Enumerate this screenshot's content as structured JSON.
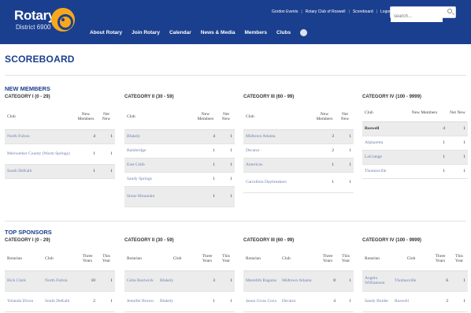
{
  "header": {
    "logo": {
      "name": "Rotary",
      "district": "District 6900"
    },
    "utility_links": [
      "Gordon Events",
      "Rotary Club of Roswell",
      "Scoreboard",
      "Logout"
    ],
    "search": {
      "placeholder": "search..."
    },
    "nav": [
      "About Rotary",
      "Join Rotary",
      "Calendar",
      "News & Media",
      "Members",
      "Clubs"
    ]
  },
  "page": {
    "title": "SCOREBOARD"
  },
  "new_members": {
    "title": "NEW MEMBERS",
    "categories": [
      {
        "title": "CATEGORY I (0 - 29)",
        "headers": [
          "Club",
          "New Members",
          "Net New"
        ],
        "rows": [
          [
            "North Fulton",
            "4",
            "1"
          ],
          [
            "Meriwether County (Warm Springs)",
            "1",
            "1"
          ],
          [
            "South DeKalb",
            "1",
            "1"
          ]
        ]
      },
      {
        "title": "CATEGORY II (30 - 59)",
        "headers": [
          "Club",
          "New Members",
          "Net New"
        ],
        "rows": [
          [
            "Blakely",
            "4",
            "1"
          ],
          [
            "Bainbridge",
            "1",
            "1"
          ],
          [
            "East Cobb",
            "1",
            "1"
          ],
          [
            "Sandy Springs",
            "1",
            "1"
          ],
          [
            "Stone Mountain",
            "1",
            "1"
          ]
        ]
      },
      {
        "title": "CATEGORY III (60 - 99)",
        "headers": [
          "Club",
          "New Members",
          "Net New"
        ],
        "rows": [
          [
            "Midtown Atlanta",
            "3",
            "1"
          ],
          [
            "Decatur",
            "2",
            "1"
          ],
          [
            "Americus",
            "1",
            "1"
          ],
          [
            "Carrollton Daybreakers",
            "1",
            "1"
          ]
        ]
      },
      {
        "title": "CATEGORY IV (100 - 9999)",
        "headers": [
          "Club",
          "New Members",
          "Net New"
        ],
        "rows": [
          [
            "Roswell",
            "4",
            "1"
          ],
          [
            "Alpharetta",
            "1",
            "1"
          ],
          [
            "LaGrange",
            "1",
            "1"
          ],
          [
            "Thomasville",
            "1",
            "1"
          ]
        ]
      }
    ]
  },
  "top_sponsors": {
    "title": "TOP SPONSORS",
    "categories": [
      {
        "title": "CATEGORY I (0 - 29)",
        "headers": [
          "Rotarian",
          "Club",
          "Three Years",
          "This Year"
        ],
        "rows": [
          [
            "Rick Clark",
            "North Fulton",
            "10",
            "1"
          ],
          [
            "Yolanda Dixon",
            "South DeKalb",
            "2",
            "1"
          ]
        ]
      },
      {
        "title": "CATEGORY II (30 - 59)",
        "headers": [
          "Rotarian",
          "Club",
          "Three Years",
          "This Year"
        ],
        "rows": [
          [
            "Celia Bostwick",
            "Blakely",
            "3",
            "1"
          ],
          [
            "Jennifer Brown",
            "Blakely",
            "1",
            "1"
          ]
        ]
      },
      {
        "title": "CATEGORY III (60 - 99)",
        "headers": [
          "Rotarian",
          "Club",
          "Three Years",
          "This Year"
        ],
        "rows": [
          [
            "Meredith Ragains",
            "Midtown Atlanta",
            "8",
            "1"
          ],
          [
            "Jason Cross Coxx",
            "Decatur",
            "4",
            "1"
          ]
        ]
      },
      {
        "title": "CATEGORY IV (100 - 9999)",
        "headers": [
          "Rotarian",
          "Club",
          "Three Years",
          "This Year"
        ],
        "rows": [
          [
            "Angela Williamson",
            "Thomasville",
            "6",
            "1"
          ],
          [
            "Sandy Bulder",
            "Roswell",
            "3",
            "1"
          ]
        ]
      }
    ]
  }
}
